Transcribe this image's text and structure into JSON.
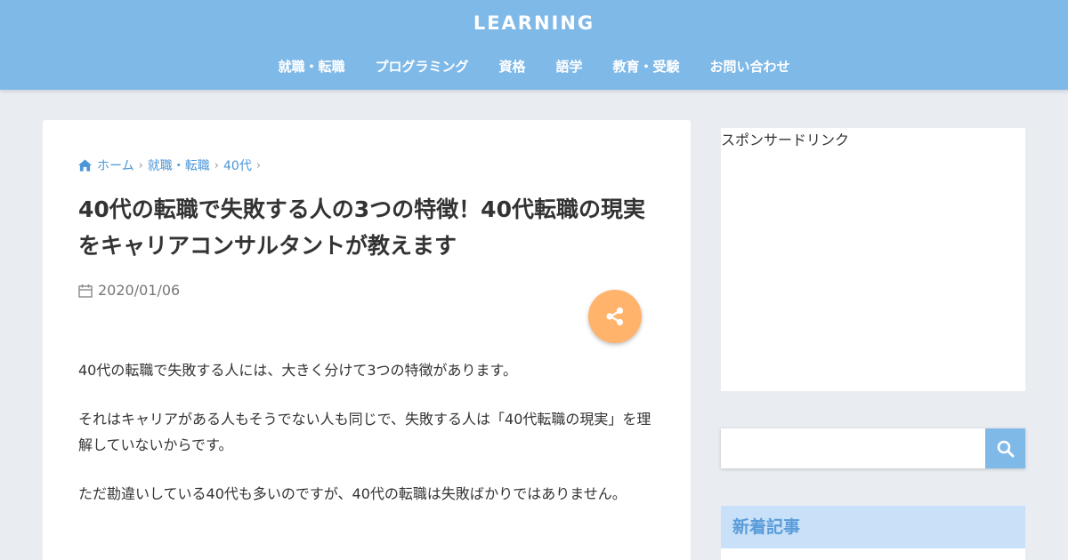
{
  "header": {
    "logo": "LEARNING",
    "nav": [
      "就職・転職",
      "プログラミング",
      "資格",
      "語学",
      "教育・受験",
      "お問い合わせ"
    ]
  },
  "breadcrumb": {
    "home": "ホーム",
    "items": [
      "就職・転職",
      "40代"
    ]
  },
  "article": {
    "title": "40代の転職で失敗する人の3つの特徴！40代転職の現実をキャリアコンサルタントが教えます",
    "date": "2020/01/06",
    "paragraphs": [
      "40代の転職で失敗する人には、大きく分けて3つの特徴があります。",
      "それはキャリアがある人もそうでない人も同じで、失敗する人は「40代転職の現実」を理解していないからです。",
      "ただ勘違いしている40代も多いのですが、40代の転職は失敗ばかりではありません。"
    ]
  },
  "sidebar": {
    "ad_label": "スポンサードリンク",
    "search_placeholder": "",
    "new_posts_title": "新着記事"
  },
  "icons": {
    "home": "home-icon",
    "calendar": "calendar-icon",
    "share": "share-icon",
    "search": "search-icon"
  },
  "colors": {
    "header": "#7fb9e8",
    "link": "#4c96d7",
    "share": "#ffb36b",
    "widget_title_bg": "#c8e1f8"
  }
}
